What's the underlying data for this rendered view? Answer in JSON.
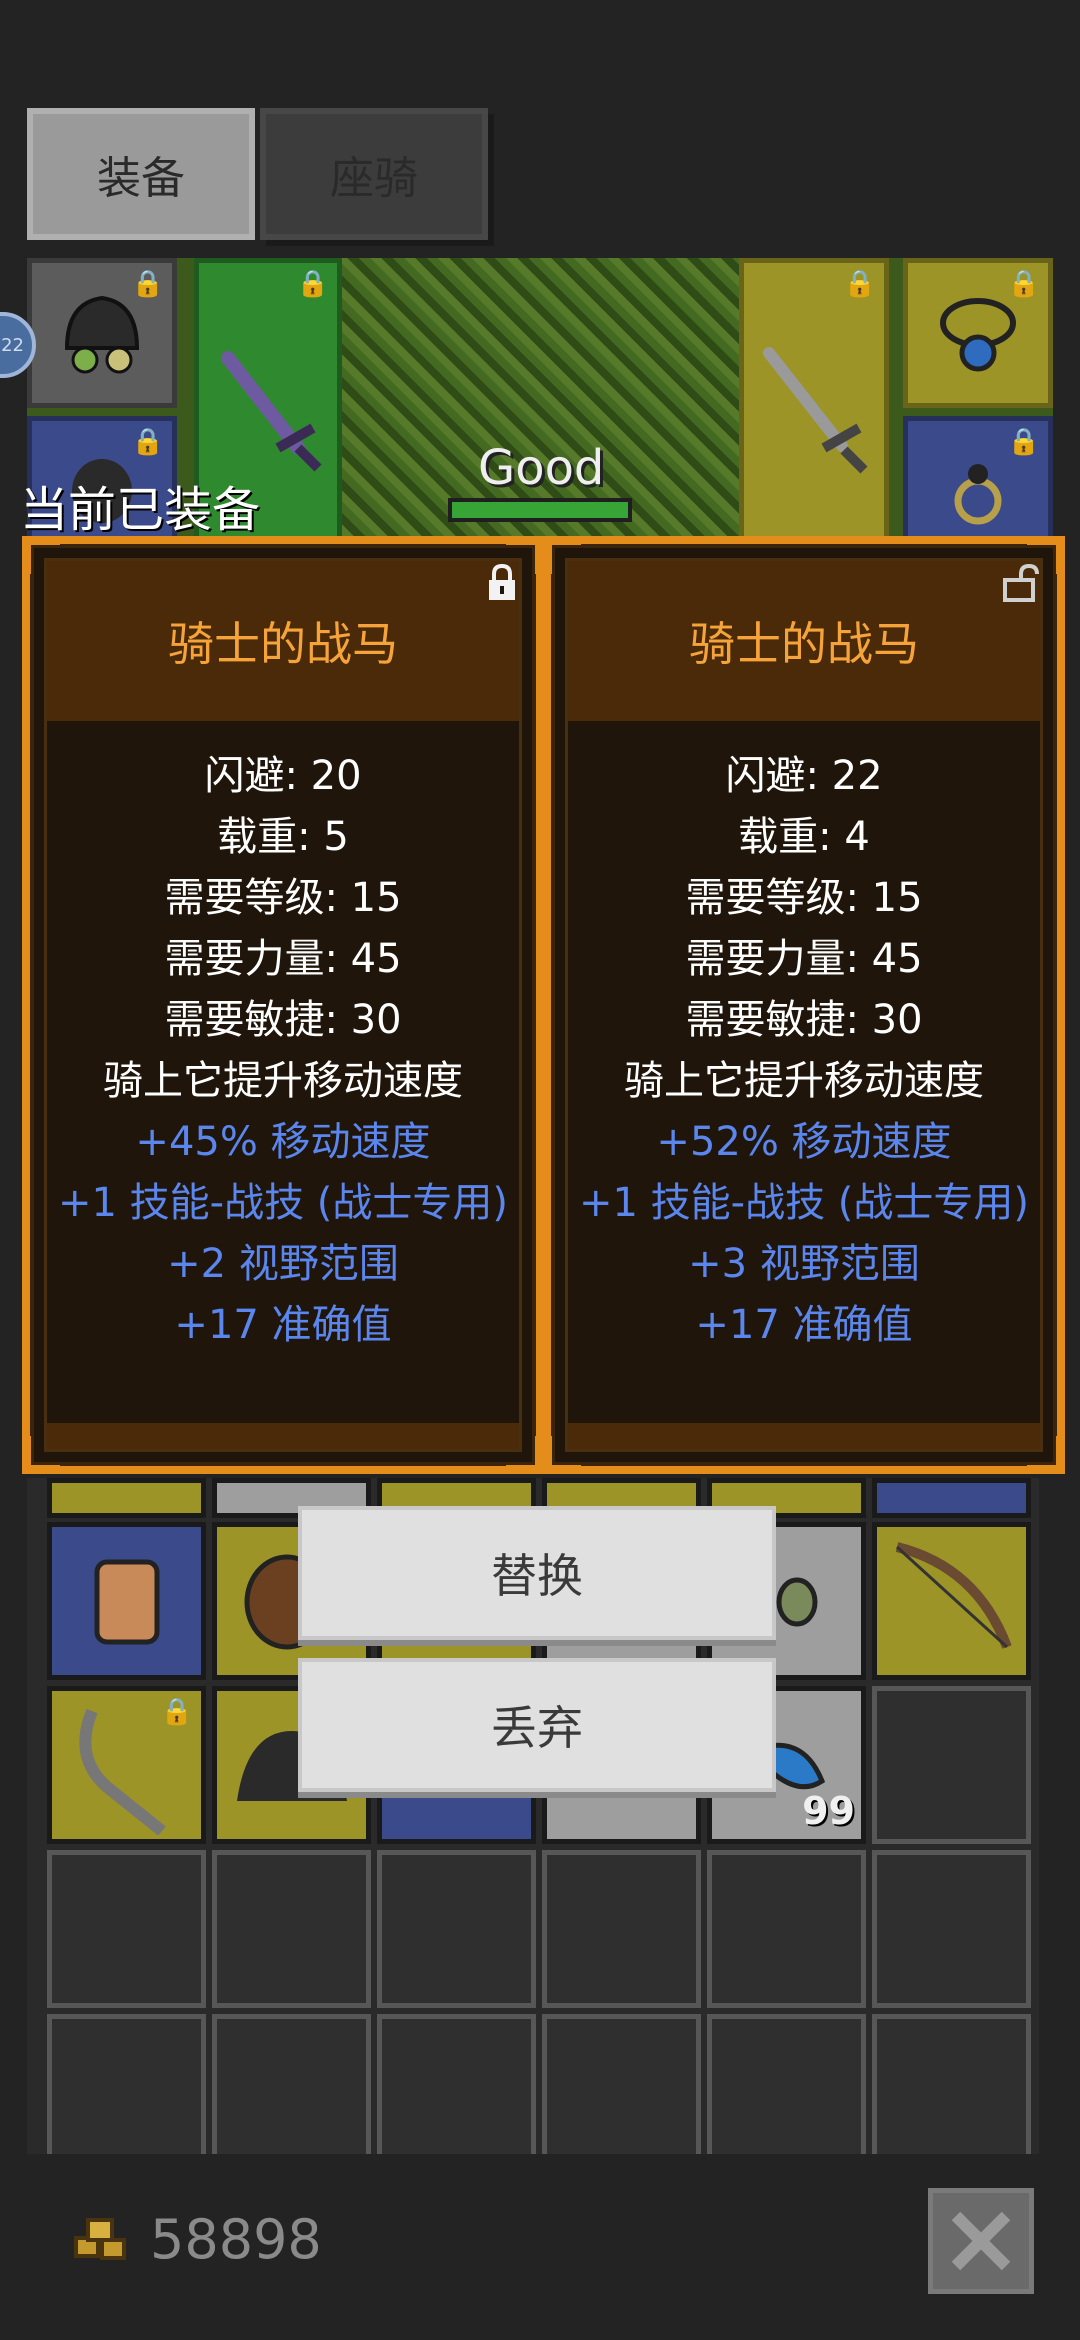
{
  "tabs": [
    {
      "label": "装备"
    },
    {
      "label": "座骑"
    }
  ],
  "character": {
    "name_label": "Good",
    "level_badge": "22"
  },
  "current_label": "当前已装备",
  "cards": [
    {
      "title": "骑士的战马",
      "lock_icon": "lock-icon",
      "stats": [
        {
          "text": "闪避: 20",
          "style": "white"
        },
        {
          "text": "载重: 5",
          "style": "white"
        },
        {
          "text": "需要等级: 15",
          "style": "white"
        },
        {
          "text": "需要力量: 45",
          "style": "white"
        },
        {
          "text": "需要敏捷: 30",
          "style": "white"
        },
        {
          "text": "骑上它提升移动速度",
          "style": "white"
        },
        {
          "text": "+45% 移动速度",
          "style": "blue"
        },
        {
          "text": "+1 技能-战技 (战士专用)",
          "style": "blue"
        },
        {
          "text": "+2 视野范围",
          "style": "blue"
        },
        {
          "text": "+17 准确值",
          "style": "blue"
        }
      ]
    },
    {
      "title": "骑士的战马",
      "lock_icon": "unlock-icon",
      "stats": [
        {
          "text": "闪避: 22",
          "style": "white"
        },
        {
          "text": "载重: 4",
          "style": "white"
        },
        {
          "text": "需要等级: 15",
          "style": "white"
        },
        {
          "text": "需要力量: 45",
          "style": "white"
        },
        {
          "text": "需要敏捷: 30",
          "style": "white"
        },
        {
          "text": "骑上它提升移动速度",
          "style": "white"
        },
        {
          "text": "+52% 移动速度",
          "style": "blue"
        },
        {
          "text": "+1 技能-战技 (战士专用)",
          "style": "blue"
        },
        {
          "text": "+3 视野范围",
          "style": "blue"
        },
        {
          "text": "+17 准确值",
          "style": "blue"
        }
      ]
    }
  ],
  "actions": {
    "replace_label": "替换",
    "discard_label": "丢弃"
  },
  "inventory": {
    "potion_count": "99"
  },
  "footer": {
    "gold_amount": "58898"
  },
  "colors": {
    "card_border": "#e58d1a",
    "title_orange": "#f6a43a",
    "stat_blue": "#5a86ee"
  }
}
